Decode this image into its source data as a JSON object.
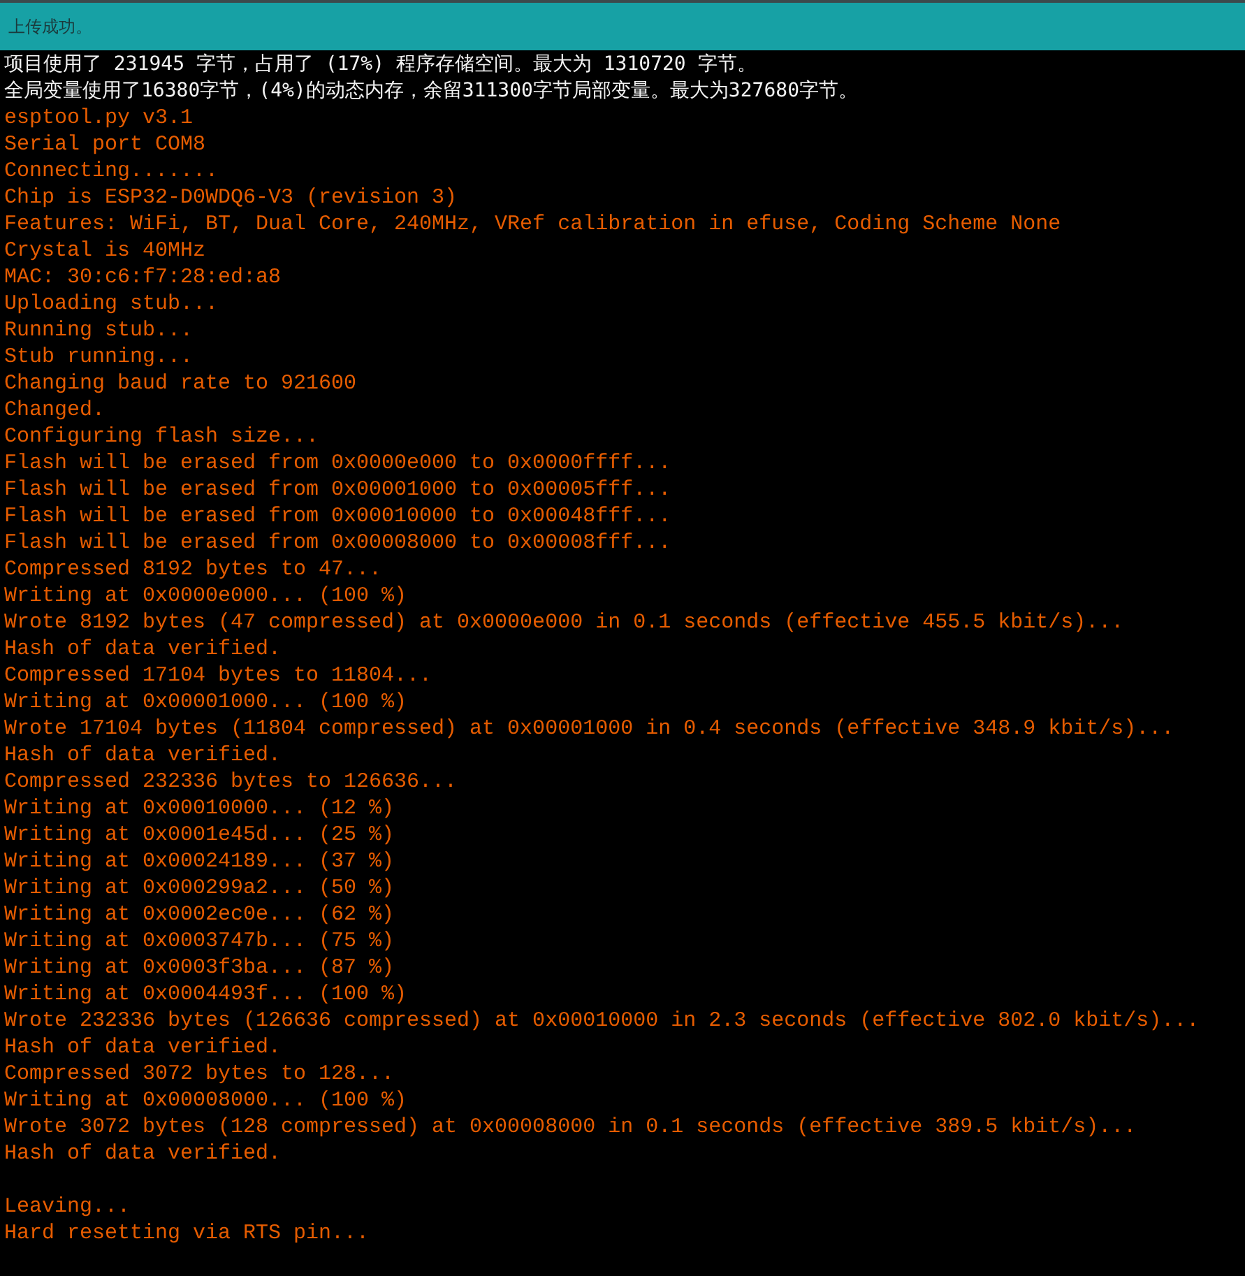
{
  "status_bar": {
    "message": "上传成功。"
  },
  "console": {
    "lines": [
      {
        "kind": "info",
        "text": "项目使用了 231945 字节，占用了 (17%) 程序存储空间。最大为 1310720 字节。"
      },
      {
        "kind": "info",
        "text": "全局变量使用了16380字节，(4%)的动态内存，余留311300字节局部变量。最大为327680字节。"
      },
      {
        "kind": "output",
        "text": "esptool.py v3.1"
      },
      {
        "kind": "output",
        "text": "Serial port COM8"
      },
      {
        "kind": "output",
        "text": "Connecting......."
      },
      {
        "kind": "output",
        "text": "Chip is ESP32-D0WDQ6-V3 (revision 3)"
      },
      {
        "kind": "output",
        "text": "Features: WiFi, BT, Dual Core, 240MHz, VRef calibration in efuse, Coding Scheme None"
      },
      {
        "kind": "output",
        "text": "Crystal is 40MHz"
      },
      {
        "kind": "output",
        "text": "MAC: 30:c6:f7:28:ed:a8"
      },
      {
        "kind": "output",
        "text": "Uploading stub..."
      },
      {
        "kind": "output",
        "text": "Running stub..."
      },
      {
        "kind": "output",
        "text": "Stub running..."
      },
      {
        "kind": "output",
        "text": "Changing baud rate to 921600"
      },
      {
        "kind": "output",
        "text": "Changed."
      },
      {
        "kind": "output",
        "text": "Configuring flash size..."
      },
      {
        "kind": "output",
        "text": "Flash will be erased from 0x0000e000 to 0x0000ffff..."
      },
      {
        "kind": "output",
        "text": "Flash will be erased from 0x00001000 to 0x00005fff..."
      },
      {
        "kind": "output",
        "text": "Flash will be erased from 0x00010000 to 0x00048fff..."
      },
      {
        "kind": "output",
        "text": "Flash will be erased from 0x00008000 to 0x00008fff..."
      },
      {
        "kind": "output",
        "text": "Compressed 8192 bytes to 47..."
      },
      {
        "kind": "output",
        "text": "Writing at 0x0000e000... (100 %)"
      },
      {
        "kind": "output",
        "text": "Wrote 8192 bytes (47 compressed) at 0x0000e000 in 0.1 seconds (effective 455.5 kbit/s)..."
      },
      {
        "kind": "output",
        "text": "Hash of data verified."
      },
      {
        "kind": "output",
        "text": "Compressed 17104 bytes to 11804..."
      },
      {
        "kind": "output",
        "text": "Writing at 0x00001000... (100 %)"
      },
      {
        "kind": "output",
        "text": "Wrote 17104 bytes (11804 compressed) at 0x00001000 in 0.4 seconds (effective 348.9 kbit/s)..."
      },
      {
        "kind": "output",
        "text": "Hash of data verified."
      },
      {
        "kind": "output",
        "text": "Compressed 232336 bytes to 126636..."
      },
      {
        "kind": "output",
        "text": "Writing at 0x00010000... (12 %)"
      },
      {
        "kind": "output",
        "text": "Writing at 0x0001e45d... (25 %)"
      },
      {
        "kind": "output",
        "text": "Writing at 0x00024189... (37 %)"
      },
      {
        "kind": "output",
        "text": "Writing at 0x000299a2... (50 %)"
      },
      {
        "kind": "output",
        "text": "Writing at 0x0002ec0e... (62 %)"
      },
      {
        "kind": "output",
        "text": "Writing at 0x0003747b... (75 %)"
      },
      {
        "kind": "output",
        "text": "Writing at 0x0003f3ba... (87 %)"
      },
      {
        "kind": "output",
        "text": "Writing at 0x0004493f... (100 %)"
      },
      {
        "kind": "output",
        "text": "Wrote 232336 bytes (126636 compressed) at 0x00010000 in 2.3 seconds (effective 802.0 kbit/s)..."
      },
      {
        "kind": "output",
        "text": "Hash of data verified."
      },
      {
        "kind": "output",
        "text": "Compressed 3072 bytes to 128..."
      },
      {
        "kind": "output",
        "text": "Writing at 0x00008000... (100 %)"
      },
      {
        "kind": "output",
        "text": "Wrote 3072 bytes (128 compressed) at 0x00008000 in 0.1 seconds (effective 389.5 kbit/s)..."
      },
      {
        "kind": "output",
        "text": "Hash of data verified."
      },
      {
        "kind": "blank"
      },
      {
        "kind": "output",
        "text": "Leaving..."
      },
      {
        "kind": "output",
        "text": "Hard resetting via RTS pin..."
      }
    ]
  }
}
